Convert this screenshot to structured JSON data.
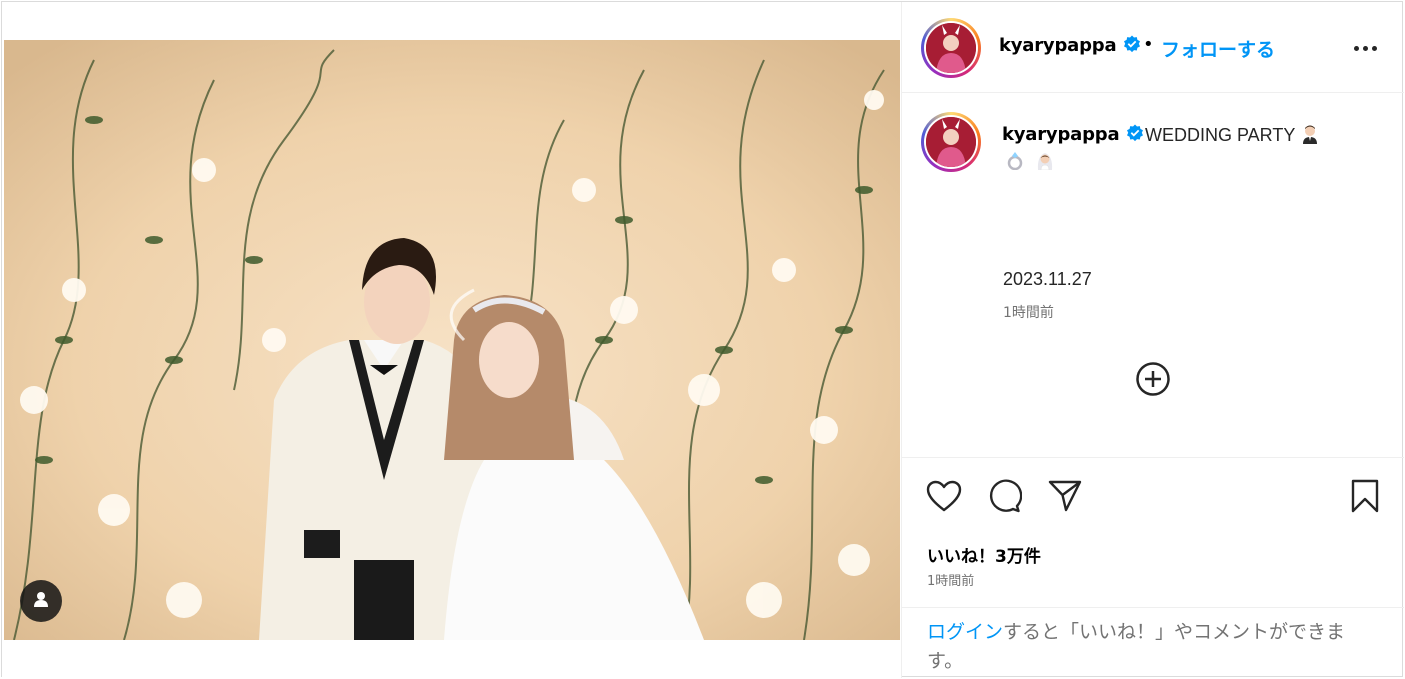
{
  "post": {
    "image_alt": "wedding photo",
    "tag_icon": "user-tag-icon"
  },
  "header": {
    "username": "kyarypappa",
    "separator": "•",
    "follow_label": "フォローする",
    "more_icon": "more-horizontal-icon"
  },
  "caption": {
    "username": "kyarypappa",
    "text": "WEDDING PARTY",
    "emojis": [
      "groom-emoji",
      "ring-emoji",
      "bride-emoji"
    ],
    "date": "2023.11.27",
    "time_ago": "1時間前"
  },
  "actions": {
    "like_icon": "heart-icon",
    "comment_icon": "comment-icon",
    "share_icon": "share-icon",
    "save_icon": "bookmark-icon",
    "load_more_icon": "plus-circle-icon"
  },
  "likes_text": "いいね！3万件",
  "time_ago": "1時間前",
  "login_prompt": {
    "link": "ログイン",
    "rest": "すると「いいね！」やコメントができます。"
  },
  "colors": {
    "accent": "#0095f6",
    "verified": "#0095f6",
    "muted_text": "#737373",
    "border": "#dbdbdb"
  }
}
